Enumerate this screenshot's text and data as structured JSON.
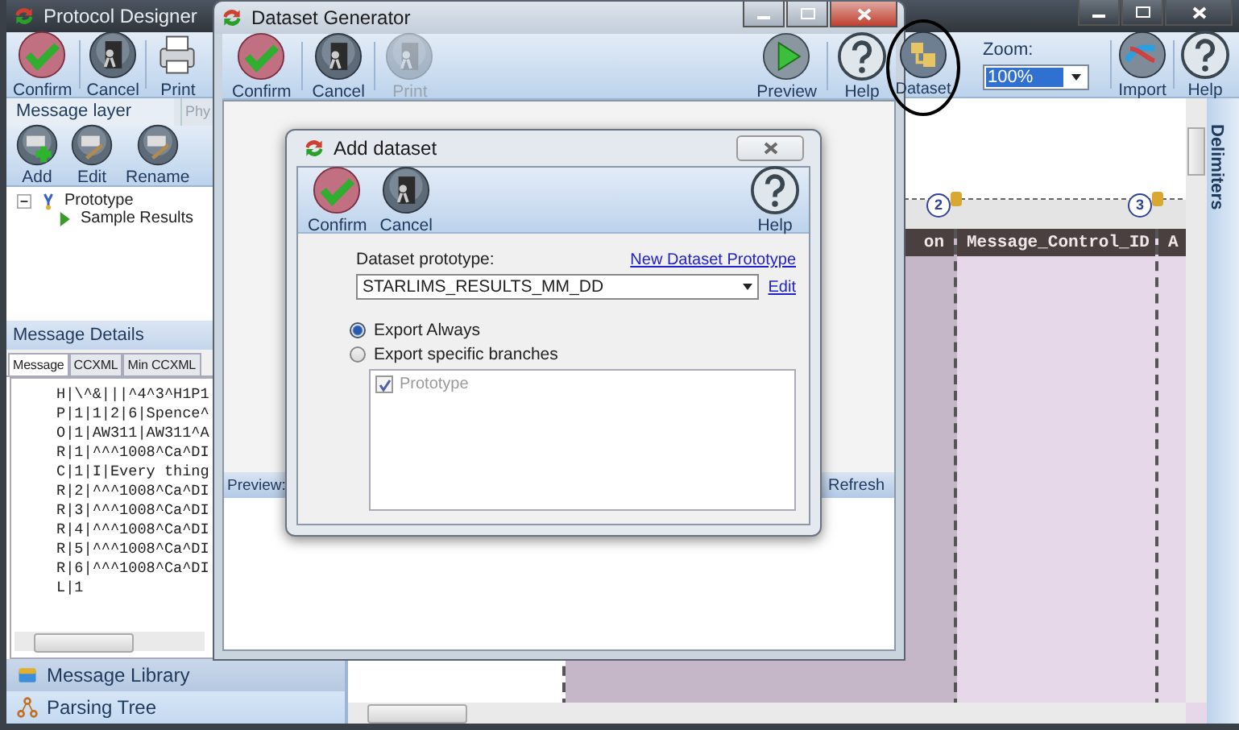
{
  "main_window": {
    "title": "Protocol Designer",
    "toolbar": [
      {
        "label": "Confirm"
      },
      {
        "label": "Cancel"
      },
      {
        "label": "Print"
      }
    ],
    "dataset_button": {
      "label": "Dataset"
    },
    "zoom": {
      "label": "Zoom:",
      "value": "100%"
    },
    "right_toolbar": [
      {
        "label": "Import"
      },
      {
        "label": "Help"
      }
    ],
    "layer_tabs": [
      {
        "label": "Message layer",
        "selected": true
      },
      {
        "label": "Phy",
        "selected": false
      }
    ],
    "layer_toolbar": [
      {
        "label": "Add"
      },
      {
        "label": "Edit"
      },
      {
        "label": "Rename"
      }
    ],
    "tree": [
      {
        "label": "Prototype",
        "expanded": true,
        "children": [
          {
            "label": "Sample Results"
          }
        ]
      }
    ],
    "message_details": {
      "title": "Message Details",
      "tabs": [
        {
          "label": "Message",
          "selected": true
        },
        {
          "label": "CCXML",
          "selected": false
        },
        {
          "label": "Min CCXML",
          "selected": false
        }
      ],
      "lines": [
        "H|\\^&|||^4^3^H1P1",
        "P|1|1|2|6|Spence^",
        "O|1|AW311|AW311^A",
        "R|1|^^^1008^Ca^DI",
        "C|1|I|Every thing",
        "R|2|^^^1008^Ca^DI",
        "R|3|^^^1008^Ca^DI",
        "R|4|^^^1008^Ca^DI",
        "R|5|^^^1008^Ca^DI",
        "R|6|^^^1008^Ca^DI",
        "L|1"
      ]
    },
    "nav": [
      {
        "label": "Message Library"
      },
      {
        "label": "Parsing Tree"
      }
    ],
    "canvas": {
      "markers": [
        "2",
        "3"
      ],
      "headers": [
        "on",
        "Message_Control_ID",
        "A"
      ]
    },
    "side_tab": "Delimiters"
  },
  "dataset_generator": {
    "title": "Dataset Generator",
    "toolbar": [
      {
        "label": "Confirm",
        "disabled": false
      },
      {
        "label": "Cancel",
        "disabled": false
      },
      {
        "label": "Print",
        "disabled": true
      }
    ],
    "right_toolbar": [
      {
        "label": "Preview"
      },
      {
        "label": "Help"
      }
    ],
    "preview_label": "Preview:",
    "refresh": "Refresh"
  },
  "add_dataset": {
    "title": "Add dataset",
    "toolbar": [
      {
        "label": "Confirm"
      },
      {
        "label": "Cancel"
      }
    ],
    "help": "Help",
    "prototype_label": "Dataset prototype:",
    "new_link": "New Dataset Prototype",
    "prototype_value": "STARLIMS_RESULTS_MM_DD",
    "edit_link": "Edit",
    "options": [
      {
        "label": "Export Always",
        "selected": true
      },
      {
        "label": "Export specific branches",
        "selected": false
      }
    ],
    "branches": [
      {
        "label": "Prototype",
        "checked": true
      }
    ]
  }
}
